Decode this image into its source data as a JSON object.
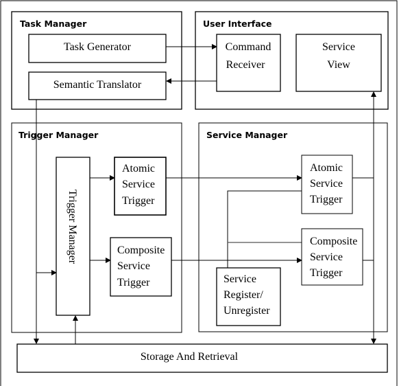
{
  "groups": {
    "task_manager": "Task Manager",
    "user_interface": "User Interface",
    "trigger_manager": "Trigger Manager",
    "service_manager": "Service Manager"
  },
  "components": {
    "task_generator": "Task Generator",
    "semantic_translator": "Semantic Translator",
    "command_receiver": [
      "Command",
      "Receiver"
    ],
    "service_view": [
      "Service",
      "View"
    ],
    "trigger_manager_vertical": "Trigger Manager",
    "atomic_left": [
      "Atomic",
      "Service",
      "Trigger"
    ],
    "composite_left": [
      "Composite",
      "Service",
      "Trigger"
    ],
    "atomic_right": [
      "Atomic",
      "Service",
      "Trigger"
    ],
    "composite_right": [
      "Composite",
      "Service",
      "Trigger"
    ],
    "service_register": [
      "Service",
      "Register/",
      "Unregister"
    ],
    "storage": "Storage And Retrieval"
  }
}
